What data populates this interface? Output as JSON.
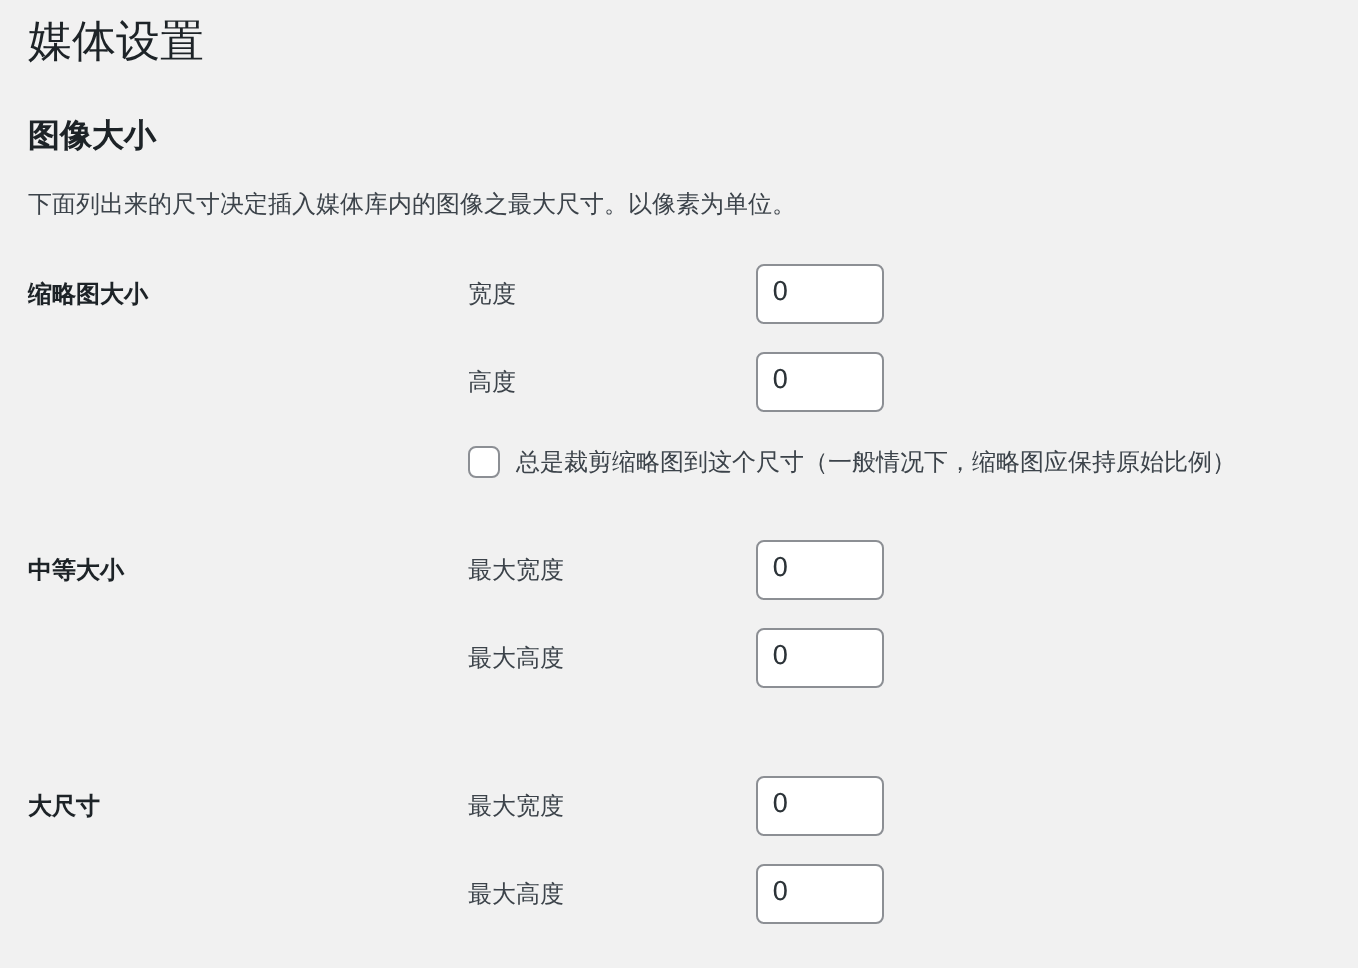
{
  "page_title": "媒体设置",
  "section": {
    "title": "图像大小",
    "description": "下面列出来的尺寸决定插入媒体库内的图像之最大尺寸。以像素为单位。"
  },
  "groups": [
    {
      "label": "缩略图大小",
      "fields": [
        {
          "label": "宽度",
          "value": "0"
        },
        {
          "label": "高度",
          "value": "0"
        }
      ],
      "checkbox": {
        "label": "总是裁剪缩略图到这个尺寸（一般情况下，缩略图应保持原始比例）",
        "checked": false
      }
    },
    {
      "label": "中等大小",
      "fields": [
        {
          "label": "最大宽度",
          "value": "0"
        },
        {
          "label": "最大高度",
          "value": "0"
        }
      ]
    },
    {
      "label": "大尺寸",
      "fields": [
        {
          "label": "最大宽度",
          "value": "0"
        },
        {
          "label": "最大高度",
          "value": "0"
        }
      ]
    }
  ]
}
